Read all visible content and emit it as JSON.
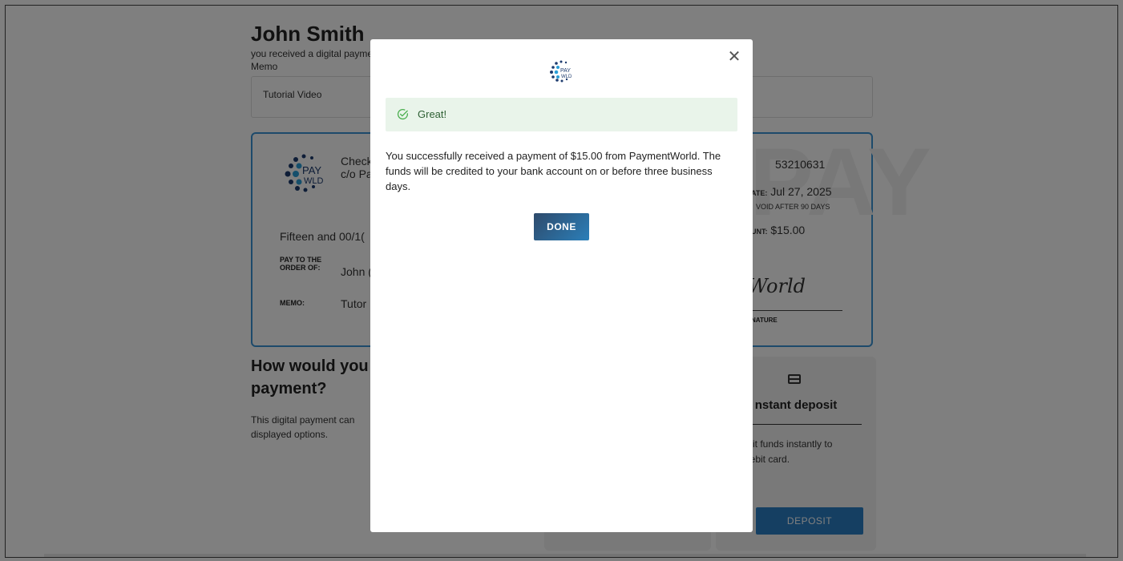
{
  "page": {
    "payee_name": "John Smith",
    "subtitle": "you received a digital payment",
    "memo_label": "Memo",
    "memo_value": "Tutorial Video"
  },
  "check": {
    "payer_line1": "Check",
    "payer_line2": "c/o Pa",
    "check_number": "53210631",
    "date_label": "ATE:",
    "date_value": "Jul 27, 2025",
    "void_text": "VOID AFTER 90 DAYS",
    "amount_label": "UNT:",
    "amount_value": "$15.00",
    "amount_words": "Fifteen and 00/1(",
    "payto_label_line1": "PAY TO THE",
    "payto_label_line2": "ORDER OF:",
    "payto_value": "John (",
    "memo_label": "MEMO:",
    "memo_value": "Tutor",
    "signature": "World",
    "signature_label": "NATURE",
    "watermark": "PAY"
  },
  "payment_options": {
    "title_line1": "How would you l",
    "title_line2": "payment?",
    "description_line1": "This digital payment can",
    "description_line2": "displayed options.",
    "instant": {
      "icon": "credit-card-icon",
      "title": "nstant deposit",
      "desc_line1": "sit funds instantly to",
      "desc_line2": "lebit card.",
      "button": "DEPOSIT"
    }
  },
  "modal": {
    "logo_icon": "paywld-logo-icon",
    "logo_text_line1": "PAY",
    "logo_text_line2": "WLD",
    "close_icon": "close-icon",
    "alert_icon": "check-circle-icon",
    "alert_text": "Great!",
    "message": "You successfully received a payment of $15.00 from PaymentWorld. The funds will be credited to your bank account on or before three business days.",
    "done_button": "DONE"
  },
  "colors": {
    "check_border": "#3b95d6",
    "alert_bg": "#e9f4ea",
    "alert_icon": "#4caf50",
    "primary_button": "#2b7fb9"
  }
}
